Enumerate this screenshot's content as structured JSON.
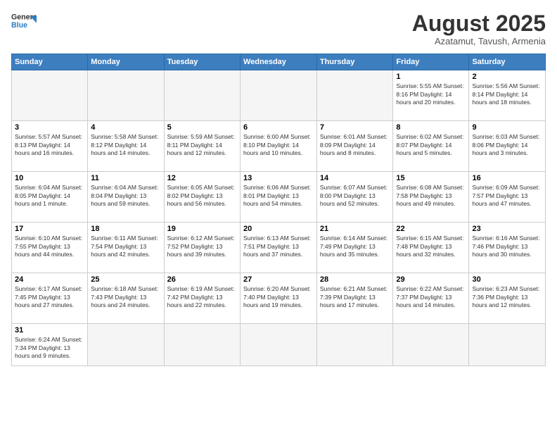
{
  "header": {
    "logo_general": "General",
    "logo_blue": "Blue",
    "month_title": "August 2025",
    "subtitle": "Azatamut, Tavush, Armenia"
  },
  "weekdays": [
    "Sunday",
    "Monday",
    "Tuesday",
    "Wednesday",
    "Thursday",
    "Friday",
    "Saturday"
  ],
  "weeks": [
    [
      {
        "day": "",
        "info": ""
      },
      {
        "day": "",
        "info": ""
      },
      {
        "day": "",
        "info": ""
      },
      {
        "day": "",
        "info": ""
      },
      {
        "day": "",
        "info": ""
      },
      {
        "day": "1",
        "info": "Sunrise: 5:55 AM\nSunset: 8:16 PM\nDaylight: 14 hours and 20 minutes."
      },
      {
        "day": "2",
        "info": "Sunrise: 5:56 AM\nSunset: 8:14 PM\nDaylight: 14 hours and 18 minutes."
      }
    ],
    [
      {
        "day": "3",
        "info": "Sunrise: 5:57 AM\nSunset: 8:13 PM\nDaylight: 14 hours and 16 minutes."
      },
      {
        "day": "4",
        "info": "Sunrise: 5:58 AM\nSunset: 8:12 PM\nDaylight: 14 hours and 14 minutes."
      },
      {
        "day": "5",
        "info": "Sunrise: 5:59 AM\nSunset: 8:11 PM\nDaylight: 14 hours and 12 minutes."
      },
      {
        "day": "6",
        "info": "Sunrise: 6:00 AM\nSunset: 8:10 PM\nDaylight: 14 hours and 10 minutes."
      },
      {
        "day": "7",
        "info": "Sunrise: 6:01 AM\nSunset: 8:09 PM\nDaylight: 14 hours and 8 minutes."
      },
      {
        "day": "8",
        "info": "Sunrise: 6:02 AM\nSunset: 8:07 PM\nDaylight: 14 hours and 5 minutes."
      },
      {
        "day": "9",
        "info": "Sunrise: 6:03 AM\nSunset: 8:06 PM\nDaylight: 14 hours and 3 minutes."
      }
    ],
    [
      {
        "day": "10",
        "info": "Sunrise: 6:04 AM\nSunset: 8:05 PM\nDaylight: 14 hours and 1 minute."
      },
      {
        "day": "11",
        "info": "Sunrise: 6:04 AM\nSunset: 8:04 PM\nDaylight: 13 hours and 59 minutes."
      },
      {
        "day": "12",
        "info": "Sunrise: 6:05 AM\nSunset: 8:02 PM\nDaylight: 13 hours and 56 minutes."
      },
      {
        "day": "13",
        "info": "Sunrise: 6:06 AM\nSunset: 8:01 PM\nDaylight: 13 hours and 54 minutes."
      },
      {
        "day": "14",
        "info": "Sunrise: 6:07 AM\nSunset: 8:00 PM\nDaylight: 13 hours and 52 minutes."
      },
      {
        "day": "15",
        "info": "Sunrise: 6:08 AM\nSunset: 7:58 PM\nDaylight: 13 hours and 49 minutes."
      },
      {
        "day": "16",
        "info": "Sunrise: 6:09 AM\nSunset: 7:57 PM\nDaylight: 13 hours and 47 minutes."
      }
    ],
    [
      {
        "day": "17",
        "info": "Sunrise: 6:10 AM\nSunset: 7:55 PM\nDaylight: 13 hours and 44 minutes."
      },
      {
        "day": "18",
        "info": "Sunrise: 6:11 AM\nSunset: 7:54 PM\nDaylight: 13 hours and 42 minutes."
      },
      {
        "day": "19",
        "info": "Sunrise: 6:12 AM\nSunset: 7:52 PM\nDaylight: 13 hours and 39 minutes."
      },
      {
        "day": "20",
        "info": "Sunrise: 6:13 AM\nSunset: 7:51 PM\nDaylight: 13 hours and 37 minutes."
      },
      {
        "day": "21",
        "info": "Sunrise: 6:14 AM\nSunset: 7:49 PM\nDaylight: 13 hours and 35 minutes."
      },
      {
        "day": "22",
        "info": "Sunrise: 6:15 AM\nSunset: 7:48 PM\nDaylight: 13 hours and 32 minutes."
      },
      {
        "day": "23",
        "info": "Sunrise: 6:16 AM\nSunset: 7:46 PM\nDaylight: 13 hours and 30 minutes."
      }
    ],
    [
      {
        "day": "24",
        "info": "Sunrise: 6:17 AM\nSunset: 7:45 PM\nDaylight: 13 hours and 27 minutes."
      },
      {
        "day": "25",
        "info": "Sunrise: 6:18 AM\nSunset: 7:43 PM\nDaylight: 13 hours and 24 minutes."
      },
      {
        "day": "26",
        "info": "Sunrise: 6:19 AM\nSunset: 7:42 PM\nDaylight: 13 hours and 22 minutes."
      },
      {
        "day": "27",
        "info": "Sunrise: 6:20 AM\nSunset: 7:40 PM\nDaylight: 13 hours and 19 minutes."
      },
      {
        "day": "28",
        "info": "Sunrise: 6:21 AM\nSunset: 7:39 PM\nDaylight: 13 hours and 17 minutes."
      },
      {
        "day": "29",
        "info": "Sunrise: 6:22 AM\nSunset: 7:37 PM\nDaylight: 13 hours and 14 minutes."
      },
      {
        "day": "30",
        "info": "Sunrise: 6:23 AM\nSunset: 7:36 PM\nDaylight: 13 hours and 12 minutes."
      }
    ],
    [
      {
        "day": "31",
        "info": "Sunrise: 6:24 AM\nSunset: 7:34 PM\nDaylight: 13 hours and 9 minutes."
      },
      {
        "day": "",
        "info": ""
      },
      {
        "day": "",
        "info": ""
      },
      {
        "day": "",
        "info": ""
      },
      {
        "day": "",
        "info": ""
      },
      {
        "day": "",
        "info": ""
      },
      {
        "day": "",
        "info": ""
      }
    ]
  ]
}
